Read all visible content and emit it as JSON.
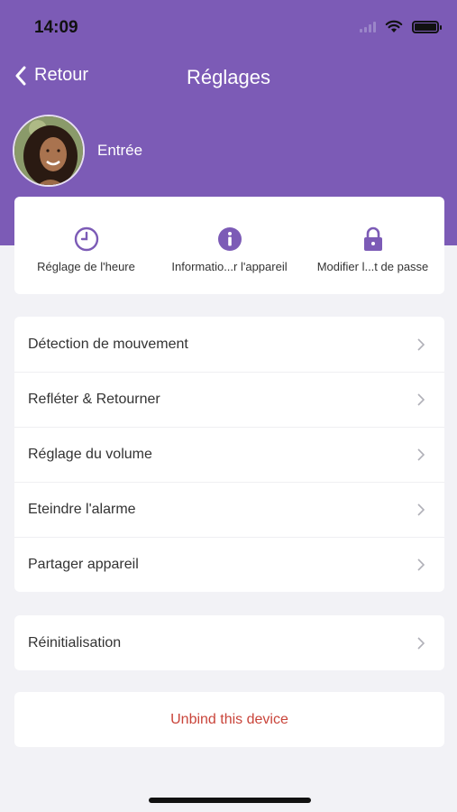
{
  "status_bar": {
    "time": "14:09"
  },
  "nav": {
    "back_label": "Retour",
    "title": "Réglages"
  },
  "profile": {
    "name": "Entrée"
  },
  "quick_actions": [
    {
      "label": "Réglage de l'heure",
      "icon": "clock-icon"
    },
    {
      "label": "Informatio...r l'appareil",
      "icon": "info-icon"
    },
    {
      "label": "Modifier l...t de passe",
      "icon": "lock-icon"
    }
  ],
  "settings_menu": [
    {
      "label": "Détection de mouvement"
    },
    {
      "label": "Refléter & Retourner"
    },
    {
      "label": "Réglage du volume"
    },
    {
      "label": "Eteindre l'alarme"
    },
    {
      "label": "Partager appareil"
    }
  ],
  "reset_menu": [
    {
      "label": "Réinitialisation"
    }
  ],
  "unbind": {
    "label": "Unbind this device"
  },
  "colors": {
    "header_purple": "#7c5bb6",
    "icon_purple": "#7c5bb6",
    "danger_red": "#c9443a",
    "background": "#f2f2f6"
  }
}
